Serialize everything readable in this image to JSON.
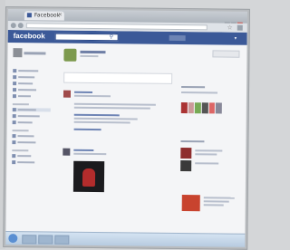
{
  "browser": {
    "tab_title": "Facebook",
    "url": "",
    "window_buttons": [
      "minimize-icon",
      "maximize-icon",
      "close-icon"
    ]
  },
  "facebook": {
    "logo": "facebook",
    "search_placeholder": "",
    "top_links": "",
    "colors": {
      "brand": "#3b5998",
      "page_bg": "#f4f5f7"
    }
  },
  "feed": {
    "status_placeholder": ""
  },
  "taskbar": {
    "clock": ""
  }
}
